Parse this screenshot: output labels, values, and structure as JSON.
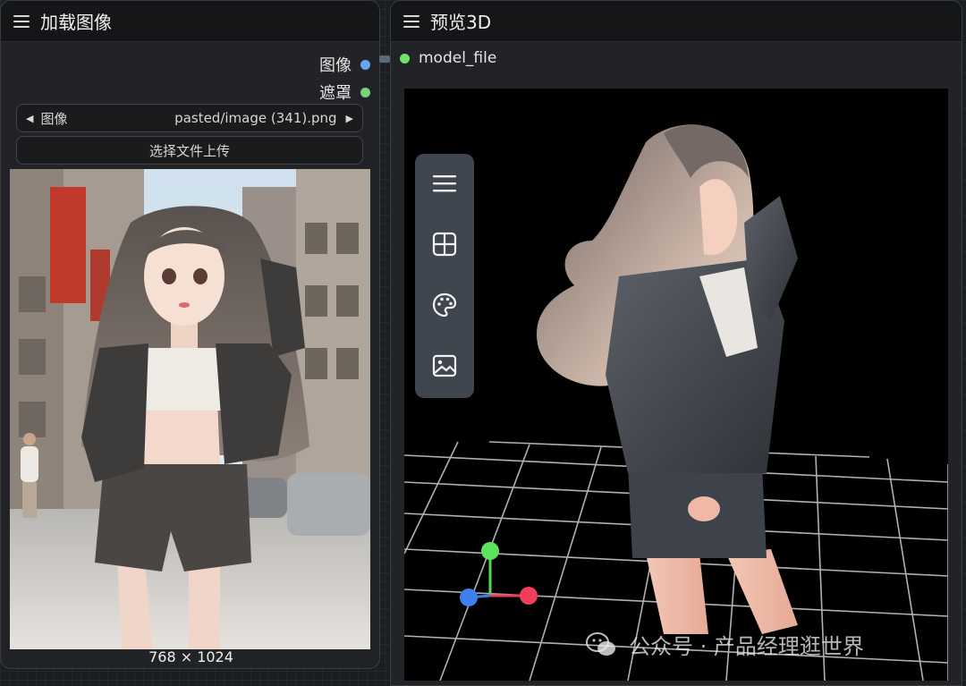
{
  "load_node": {
    "title": "加载图像",
    "outputs": [
      {
        "label": "图像",
        "color": "#64a8f0"
      },
      {
        "label": "遮罩",
        "color": "#7ad27a"
      }
    ],
    "image_combo": {
      "name": "图像",
      "value": "pasted/image (341).png"
    },
    "upload_button": "选择文件上传",
    "image_dims": "768 × 1024"
  },
  "preview_node": {
    "title": "预览3D",
    "input": {
      "label": "model_file",
      "color": "#6ee36a"
    },
    "toolbar": [
      "menu-icon",
      "layout-grid-icon",
      "palette-icon",
      "image-icon"
    ]
  },
  "watermark": "公众号 · 产品经理逛世界",
  "colors": {
    "node_bg": "#222326",
    "header_bg": "#151618",
    "toolbar_bg": "#3f4650"
  }
}
